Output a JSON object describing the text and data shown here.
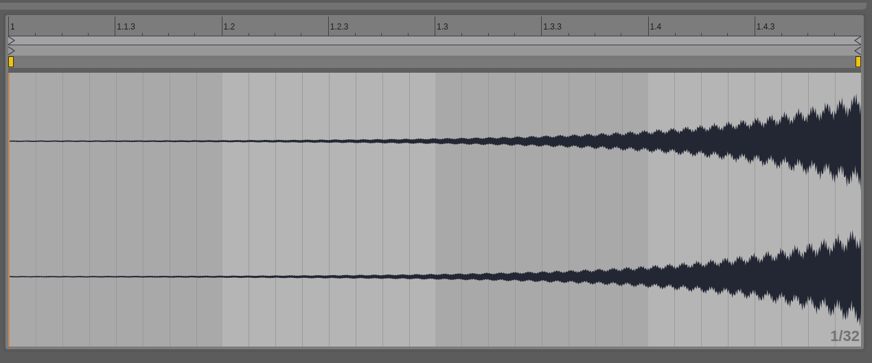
{
  "ruler": {
    "labels": [
      "1",
      "1.1.3",
      "1.2",
      "1.2.3",
      "1.3",
      "1.3.3",
      "1.4",
      "1.4.3"
    ]
  },
  "grid": {
    "label": "1/32"
  }
}
